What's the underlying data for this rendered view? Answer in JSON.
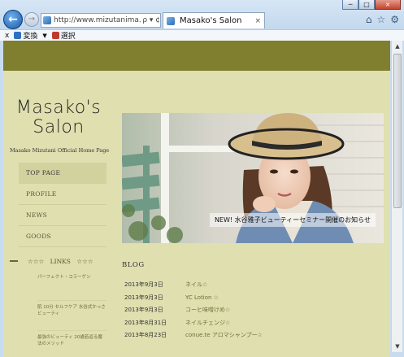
{
  "browser": {
    "url": "http://www.mizutanima...",
    "address_icons": "ρ ▾ ¢",
    "tab_title": "Masako's Salon",
    "tab_close": "×",
    "back_glyph": "←",
    "forward_glyph": "→",
    "window_controls": [
      "─",
      "□",
      "×"
    ],
    "toolbar_icons": [
      "⌂",
      "☆",
      "⚙"
    ],
    "command_bar": {
      "close": "x",
      "convert_label": "変換",
      "dropdown": "▼",
      "select_label": "選択"
    }
  },
  "site": {
    "logo_line1": "Masako's",
    "logo_line2": "Salon",
    "tagline": "Masako Mizutani Official Home Page",
    "menu": [
      {
        "label": "TOP PAGE"
      },
      {
        "label": "PROFILE"
      },
      {
        "label": "NEWS"
      },
      {
        "label": "GOODS"
      }
    ],
    "links_label": "☆☆☆　LINKS　☆☆☆",
    "sublinks": [
      {
        "label": "パーフェクト・コラーゲン"
      },
      {
        "label": "肌 10分 セルフケア 水谷式かっさビューティ"
      },
      {
        "label": "最強のビューティ 20歳若返る魔法のメソッド"
      }
    ],
    "hero_caption": "NEW! 水谷雅子ビューティーセミナー開催のお知らせ",
    "blog_title": "BLOG",
    "blog": [
      {
        "date": "2013年9月3日",
        "title": "ネイル☆"
      },
      {
        "date": "2013年9月3日",
        "title": "YC  Lotion ☆"
      },
      {
        "date": "2013年9月3日",
        "title": "コーヒ味噌けめ☆"
      },
      {
        "date": "2013年8月31日",
        "title": "ネイルチェンジ☆"
      },
      {
        "date": "2013年8月23日",
        "title": "conue.te アロマシャンプー☆"
      }
    ]
  },
  "colors": {
    "top_band": "#7f7f2f",
    "page_bg": "#dfdfb0",
    "active_menu_bg": "#d2d29f",
    "blog_link": "#6f6f34"
  }
}
